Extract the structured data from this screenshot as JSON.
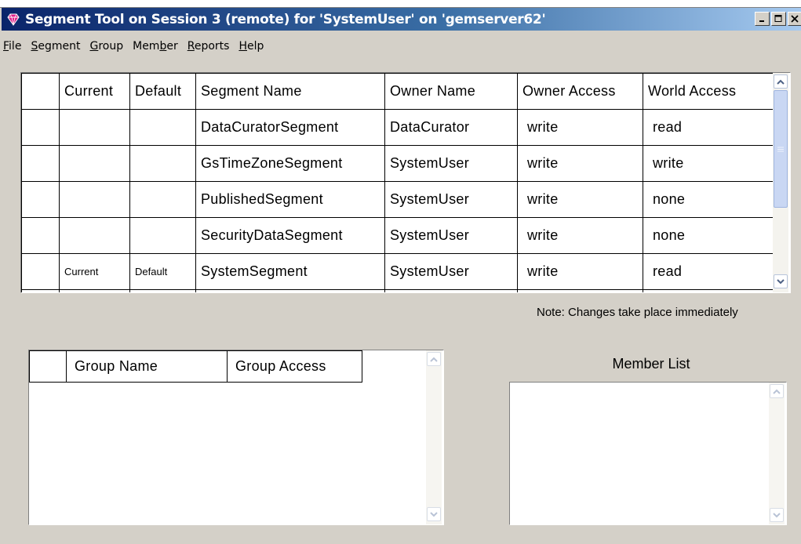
{
  "window": {
    "title": "Segment Tool on Session 3 (remote) for 'SystemUser' on 'gemserver62'",
    "controls": [
      "minimize",
      "maximize",
      "close"
    ],
    "app_icon": "gem-icon"
  },
  "menu": [
    {
      "mnemonic": "F",
      "rest": "ile"
    },
    {
      "mnemonic": "S",
      "rest": "egment"
    },
    {
      "mnemonic": "G",
      "rest": "roup"
    },
    {
      "pre": "Mem",
      "mnemonic": "b",
      "rest": "er"
    },
    {
      "mnemonic": "R",
      "rest": "eports"
    },
    {
      "mnemonic": "H",
      "rest": "elp"
    }
  ],
  "segments": {
    "columns": [
      "",
      "Current",
      "Default",
      "Segment Name",
      "Owner Name",
      "Owner Access",
      "World Access"
    ],
    "rows": [
      {
        "current": "",
        "default": "",
        "name": "DataCuratorSegment",
        "owner": "DataCurator",
        "owner_access": "write",
        "world_access": "read"
      },
      {
        "current": "",
        "default": "",
        "name": "GsTimeZoneSegment",
        "owner": "SystemUser",
        "owner_access": "write",
        "world_access": "write"
      },
      {
        "current": "",
        "default": "",
        "name": "PublishedSegment",
        "owner": "SystemUser",
        "owner_access": "write",
        "world_access": "none"
      },
      {
        "current": "",
        "default": "",
        "name": "SecurityDataSegment",
        "owner": "SystemUser",
        "owner_access": "write",
        "world_access": "none"
      },
      {
        "current": "Current",
        "default": "Default",
        "name": "SystemSegment",
        "owner": "SystemUser",
        "owner_access": "write",
        "world_access": "read"
      }
    ]
  },
  "note": "Note: Changes take place immediately",
  "groups": {
    "columns": [
      "",
      "Group Name",
      "Group Access"
    ],
    "rows": []
  },
  "members": {
    "label": "Member List",
    "items": []
  }
}
